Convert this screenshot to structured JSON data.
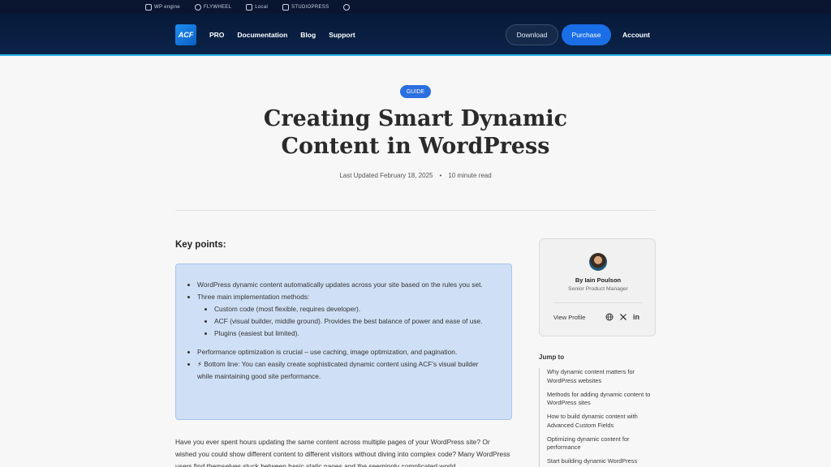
{
  "partners": [
    "WP engine",
    "FLYWHEEL",
    "Local",
    "STUDIOPRESS",
    ""
  ],
  "nav": {
    "logo": "ACF",
    "links": [
      "PRO",
      "Documentation",
      "Blog",
      "Support"
    ],
    "download": "Download",
    "purchase": "Purchase",
    "account": "Account"
  },
  "article": {
    "tag": "GUIDE",
    "title": "Creating Smart Dynamic Content in WordPress",
    "updated": "Last Updated February 18, 2025",
    "read_time": "10 minute read"
  },
  "key_points": {
    "heading": "Key points:",
    "items": [
      "WordPress dynamic content automatically updates across your site based on the rules you set.",
      "Three main implementation methods:",
      "Performance optimization is crucial – use caching, image optimization, and pagination.",
      "⚡ Bottom line: You can easily create sophisticated dynamic content using ACF's visual builder while maintaining good site performance."
    ],
    "methods": [
      "Custom code (most flexible, requires developer).",
      "ACF (visual builder, middle ground). Provides the best balance of power and ease of use.",
      "Plugins (easiest but limited)."
    ]
  },
  "intro": "Have you ever spent hours updating the same content across multiple pages of your WordPress site? Or wished you could show different content to different visitors without diving into complex code? Many WordPress users find themselves stuck between basic static pages and the seemingly complicated world",
  "author": {
    "name": "By Iain Poulson",
    "role": "Senior Product Manager",
    "view_profile": "View Profile",
    "icons": [
      "globe-icon",
      "x-icon",
      "linkedin-icon"
    ]
  },
  "jump_to": {
    "title": "Jump to",
    "items": [
      "Why dynamic content matters for WordPress websites",
      "Methods for adding dynamic content to WordPress sites",
      "How to build dynamic content with Advanced Custom Fields",
      "Optimizing dynamic content for performance",
      "Start building dynamic WordPress"
    ]
  },
  "colors": {
    "nav_bg": "#0b2348",
    "accent": "#1a6ee6",
    "key_points_bg": "#cfe0f6"
  }
}
